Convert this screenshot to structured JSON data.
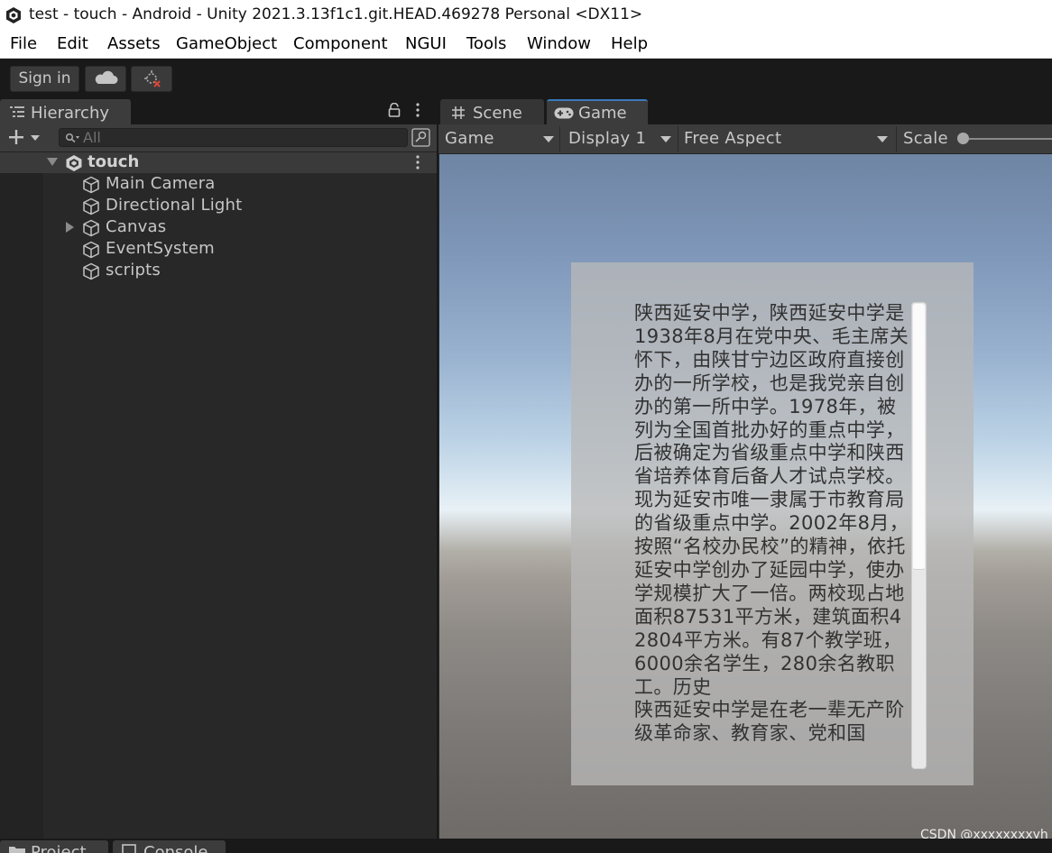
{
  "window": {
    "title": "test - touch - Android - Unity 2021.3.13f1c1.git.HEAD.469278 Personal <DX11>"
  },
  "menu": [
    "File",
    "Edit",
    "Assets",
    "GameObject",
    "Component",
    "NGUI",
    "Tools",
    "Window",
    "Help"
  ],
  "toolbar": {
    "sign_in": "Sign in",
    "cloud_icon": "cloud-icon",
    "collab_icon": "collab-error-icon"
  },
  "hierarchy": {
    "tab_label": "Hierarchy",
    "search_placeholder": "All",
    "scene_name": "touch",
    "objects": [
      {
        "label": "Main Camera",
        "has_children": false
      },
      {
        "label": "Directional Light",
        "has_children": false
      },
      {
        "label": "Canvas",
        "has_children": true
      },
      {
        "label": "EventSystem",
        "has_children": false
      },
      {
        "label": "scripts",
        "has_children": false
      }
    ]
  },
  "game_view": {
    "tabs": [
      "Scene",
      "Game"
    ],
    "active_tab": "Game",
    "mode": "Game",
    "display": "Display 1",
    "aspect": "Free Aspect",
    "scale_label": "Scale",
    "scroll_text": "陕西延安中学，陕西延安中学是1938年8月在党中央、毛主席关怀下，由陕甘宁边区政府直接创办的一所学校，也是我党亲自创办的第一所中学。1978年，被列为全国首批办好的重点中学，后被确定为省级重点中学和陕西省培养体育后备人才试点学校。现为延安市唯一隶属于市教育局的省级重点中学。2002年8月，按照“名校办民校”的精神，依托延安中学创办了延园中学，使办学规模扩大了一倍。两校现占地面积87531平方米，建筑面积42804平方米。有87个教学班，6000余名学生，280余名教职工。历史\n陕西延安中学是在老一辈无产阶级革命家、教育家、党和国",
    "scrollbar_position": 0
  },
  "bottom_tabs": [
    "Project",
    "Console"
  ],
  "watermark": "CSDN @xxxxxxxxyh"
}
